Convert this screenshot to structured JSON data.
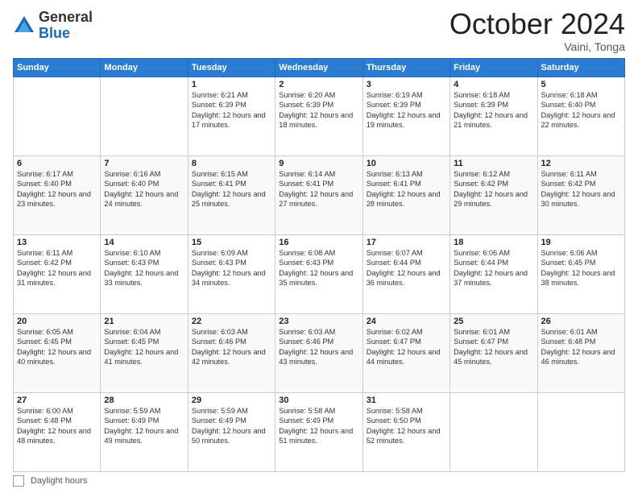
{
  "logo": {
    "general": "General",
    "blue": "Blue"
  },
  "header": {
    "month": "October 2024",
    "location": "Vaini, Tonga"
  },
  "weekdays": [
    "Sunday",
    "Monday",
    "Tuesday",
    "Wednesday",
    "Thursday",
    "Friday",
    "Saturday"
  ],
  "footer": {
    "label": "Daylight hours"
  },
  "weeks": [
    [
      {
        "day": "",
        "info": ""
      },
      {
        "day": "",
        "info": ""
      },
      {
        "day": "1",
        "sunrise": "6:21 AM",
        "sunset": "6:39 PM",
        "daylight": "12 hours and 17 minutes."
      },
      {
        "day": "2",
        "sunrise": "6:20 AM",
        "sunset": "6:39 PM",
        "daylight": "12 hours and 18 minutes."
      },
      {
        "day": "3",
        "sunrise": "6:19 AM",
        "sunset": "6:39 PM",
        "daylight": "12 hours and 19 minutes."
      },
      {
        "day": "4",
        "sunrise": "6:18 AM",
        "sunset": "6:39 PM",
        "daylight": "12 hours and 21 minutes."
      },
      {
        "day": "5",
        "sunrise": "6:18 AM",
        "sunset": "6:40 PM",
        "daylight": "12 hours and 22 minutes."
      }
    ],
    [
      {
        "day": "6",
        "sunrise": "6:17 AM",
        "sunset": "6:40 PM",
        "daylight": "12 hours and 23 minutes."
      },
      {
        "day": "7",
        "sunrise": "6:16 AM",
        "sunset": "6:40 PM",
        "daylight": "12 hours and 24 minutes."
      },
      {
        "day": "8",
        "sunrise": "6:15 AM",
        "sunset": "6:41 PM",
        "daylight": "12 hours and 25 minutes."
      },
      {
        "day": "9",
        "sunrise": "6:14 AM",
        "sunset": "6:41 PM",
        "daylight": "12 hours and 27 minutes."
      },
      {
        "day": "10",
        "sunrise": "6:13 AM",
        "sunset": "6:41 PM",
        "daylight": "12 hours and 28 minutes."
      },
      {
        "day": "11",
        "sunrise": "6:12 AM",
        "sunset": "6:42 PM",
        "daylight": "12 hours and 29 minutes."
      },
      {
        "day": "12",
        "sunrise": "6:11 AM",
        "sunset": "6:42 PM",
        "daylight": "12 hours and 30 minutes."
      }
    ],
    [
      {
        "day": "13",
        "sunrise": "6:11 AM",
        "sunset": "6:42 PM",
        "daylight": "12 hours and 31 minutes."
      },
      {
        "day": "14",
        "sunrise": "6:10 AM",
        "sunset": "6:43 PM",
        "daylight": "12 hours and 33 minutes."
      },
      {
        "day": "15",
        "sunrise": "6:09 AM",
        "sunset": "6:43 PM",
        "daylight": "12 hours and 34 minutes."
      },
      {
        "day": "16",
        "sunrise": "6:08 AM",
        "sunset": "6:43 PM",
        "daylight": "12 hours and 35 minutes."
      },
      {
        "day": "17",
        "sunrise": "6:07 AM",
        "sunset": "6:44 PM",
        "daylight": "12 hours and 36 minutes."
      },
      {
        "day": "18",
        "sunrise": "6:06 AM",
        "sunset": "6:44 PM",
        "daylight": "12 hours and 37 minutes."
      },
      {
        "day": "19",
        "sunrise": "6:06 AM",
        "sunset": "6:45 PM",
        "daylight": "12 hours and 38 minutes."
      }
    ],
    [
      {
        "day": "20",
        "sunrise": "6:05 AM",
        "sunset": "6:45 PM",
        "daylight": "12 hours and 40 minutes."
      },
      {
        "day": "21",
        "sunrise": "6:04 AM",
        "sunset": "6:45 PM",
        "daylight": "12 hours and 41 minutes."
      },
      {
        "day": "22",
        "sunrise": "6:03 AM",
        "sunset": "6:46 PM",
        "daylight": "12 hours and 42 minutes."
      },
      {
        "day": "23",
        "sunrise": "6:03 AM",
        "sunset": "6:46 PM",
        "daylight": "12 hours and 43 minutes."
      },
      {
        "day": "24",
        "sunrise": "6:02 AM",
        "sunset": "6:47 PM",
        "daylight": "12 hours and 44 minutes."
      },
      {
        "day": "25",
        "sunrise": "6:01 AM",
        "sunset": "6:47 PM",
        "daylight": "12 hours and 45 minutes."
      },
      {
        "day": "26",
        "sunrise": "6:01 AM",
        "sunset": "6:48 PM",
        "daylight": "12 hours and 46 minutes."
      }
    ],
    [
      {
        "day": "27",
        "sunrise": "6:00 AM",
        "sunset": "6:48 PM",
        "daylight": "12 hours and 48 minutes."
      },
      {
        "day": "28",
        "sunrise": "5:59 AM",
        "sunset": "6:49 PM",
        "daylight": "12 hours and 49 minutes."
      },
      {
        "day": "29",
        "sunrise": "5:59 AM",
        "sunset": "6:49 PM",
        "daylight": "12 hours and 50 minutes."
      },
      {
        "day": "30",
        "sunrise": "5:58 AM",
        "sunset": "6:49 PM",
        "daylight": "12 hours and 51 minutes."
      },
      {
        "day": "31",
        "sunrise": "5:58 AM",
        "sunset": "6:50 PM",
        "daylight": "12 hours and 52 minutes."
      },
      {
        "day": "",
        "info": ""
      },
      {
        "day": "",
        "info": ""
      }
    ]
  ]
}
